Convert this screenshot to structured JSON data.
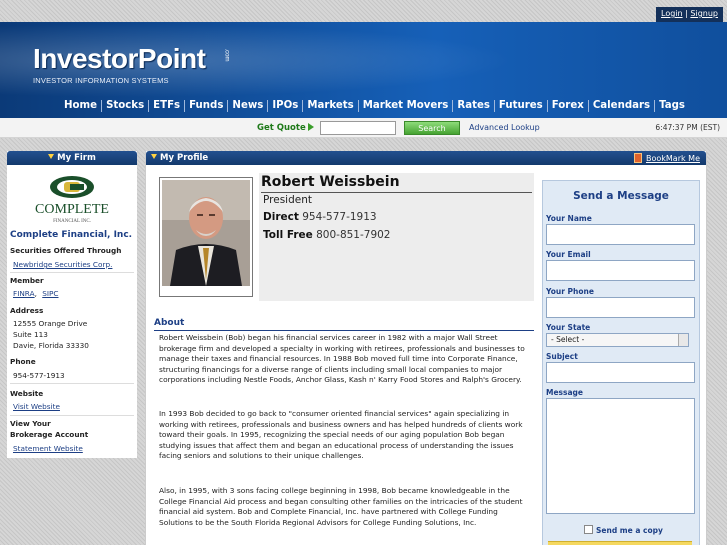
{
  "top": {
    "login": "Login",
    "sep": "|",
    "signup": "Signup"
  },
  "header": {
    "logo": "InvestorPoint",
    "logo_suffix": ".com",
    "tagline": "INVESTOR INFORMATION SYSTEMS",
    "nav": [
      "Home",
      "Stocks",
      "ETFs",
      "Funds",
      "News",
      "IPOs",
      "Markets",
      "Market Movers",
      "Rates",
      "Futures",
      "Forex",
      "Calendars",
      "Tags"
    ]
  },
  "quotebar": {
    "label": "Get Quote",
    "input_value": "",
    "search_button": "Search",
    "advanced": "Advanced Lookup",
    "time": "6:47:37 PM (EST)"
  },
  "firm": {
    "heading": "My Firm",
    "logo_text": "COMPLETE",
    "logo_sub": "FINANCIAL INC.",
    "name": "Complete Financial, Inc.",
    "securities_label": "Securities Offered Through",
    "securities_link": "Newbridge Securities Corp.",
    "member_label": "Member",
    "member_link1": "FINRA",
    "member_comma": ",",
    "member_link2": "SIPC",
    "address_label": "Address",
    "address_lines": [
      "12555 Orange Drive",
      "Suite 113",
      "Davie, Florida 33330"
    ],
    "phone_label": "Phone",
    "phone": "954-577-1913",
    "website_label": "Website",
    "website_link": "Visit Website",
    "view_label_1": "View Your",
    "view_label_2": "Brokerage Account",
    "statement_link": "Statement Website"
  },
  "profile": {
    "heading": "My Profile",
    "bookmark": "BookMark Me",
    "name": "Robert Weissbein",
    "title": "President",
    "direct_label": "Direct",
    "direct": "954-577-1913",
    "tollfree_label": "Toll Free",
    "tollfree": "800-851-7902",
    "about_heading": "About",
    "about_paragraphs": [
      "Robert Weissbein (Bob) began his financial services career in 1982 with a major Wall Street brokerage firm and developed a specialty in working with retirees, professionals and businesses to manage their taxes and financial resources. In 1988 Bob moved full time into Corporate Finance, structuring financings for a diverse range of clients including small local companies to major corporations including Nestle Foods, Anchor Glass, Kash n' Karry Food Stores and Ralph's Grocery.",
      "In 1993 Bob decided to go back to \"consumer oriented financial services\" again specializing in working with retirees, professionals and business owners and has helped hundreds of clients work toward their goals. In 1995, recognizing the special needs of our aging population Bob began studying issues that affect them and began an educational process of understanding the issues facing seniors and solutions to their unique challenges.",
      "Also, in 1995, with 3 sons facing college beginning in 1998, Bob became knowledgeable in the College Financial Aid process and began consulting other families on the intricacies of the student financial aid system. Bob and Complete Financial, Inc. have partnered with College Funding Solutions to be the South Florida Regional Advisors for College Funding Solutions, Inc."
    ]
  },
  "message_form": {
    "title": "Send a Message",
    "name_label": "Your Name",
    "email_label": "Your Email",
    "phone_label": "Your Phone",
    "state_label": "Your State",
    "state_value": "- Select -",
    "subject_label": "Subject",
    "message_label": "Message",
    "copy_label": "Send me a copy"
  }
}
